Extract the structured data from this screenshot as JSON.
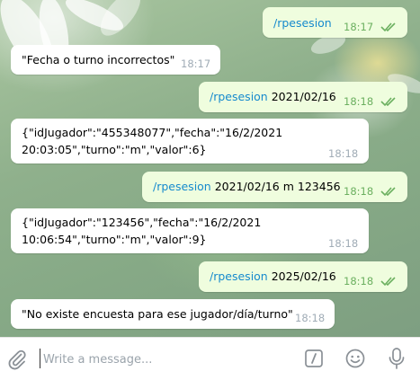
{
  "messages": [
    {
      "id": "m1",
      "dir": "out",
      "cmd": "/rpesesion",
      "args": "",
      "time": "18:17",
      "read": true
    },
    {
      "id": "m2",
      "dir": "in",
      "text": "\"Fecha o turno incorrectos\"",
      "time": "18:17"
    },
    {
      "id": "m3",
      "dir": "out",
      "cmd": "/rpesesion",
      "args": "2021/02/16",
      "time": "18:18",
      "read": true
    },
    {
      "id": "m4",
      "dir": "in",
      "text": "{\"idJugador\":\"455348077\",\"fecha\":\"16/2/2021\n20:03:05\",\"turno\":\"m\",\"valor\":6}",
      "time": "18:18"
    },
    {
      "id": "m5",
      "dir": "out",
      "cmd": "/rpesesion",
      "args": "2021/02/16 m 123456",
      "time": "18:18",
      "read": true
    },
    {
      "id": "m6",
      "dir": "in",
      "text": "{\"idJugador\":\"123456\",\"fecha\":\"16/2/2021\n10:06:54\",\"turno\":\"m\",\"valor\":9}",
      "time": "18:18"
    },
    {
      "id": "m7",
      "dir": "out",
      "cmd": "/rpesesion",
      "args": "2025/02/16",
      "time": "18:18",
      "read": true
    },
    {
      "id": "m8",
      "dir": "in",
      "text": "\"No existe encuesta para ese jugador/día/turno\"",
      "time": "18:18"
    }
  ],
  "composer": {
    "placeholder": "Write a message...",
    "icons": {
      "attach": "paperclip-icon",
      "commands": "slash-commands-icon",
      "emoji": "emoji-icon",
      "voice": "microphone-icon"
    }
  },
  "colors": {
    "outgoing_bubble": "#effdde",
    "incoming_bubble": "#ffffff",
    "command_link": "#168acd",
    "outgoing_time": "#6cb060",
    "incoming_time": "#a0acb6",
    "icons": "#8a9096"
  }
}
